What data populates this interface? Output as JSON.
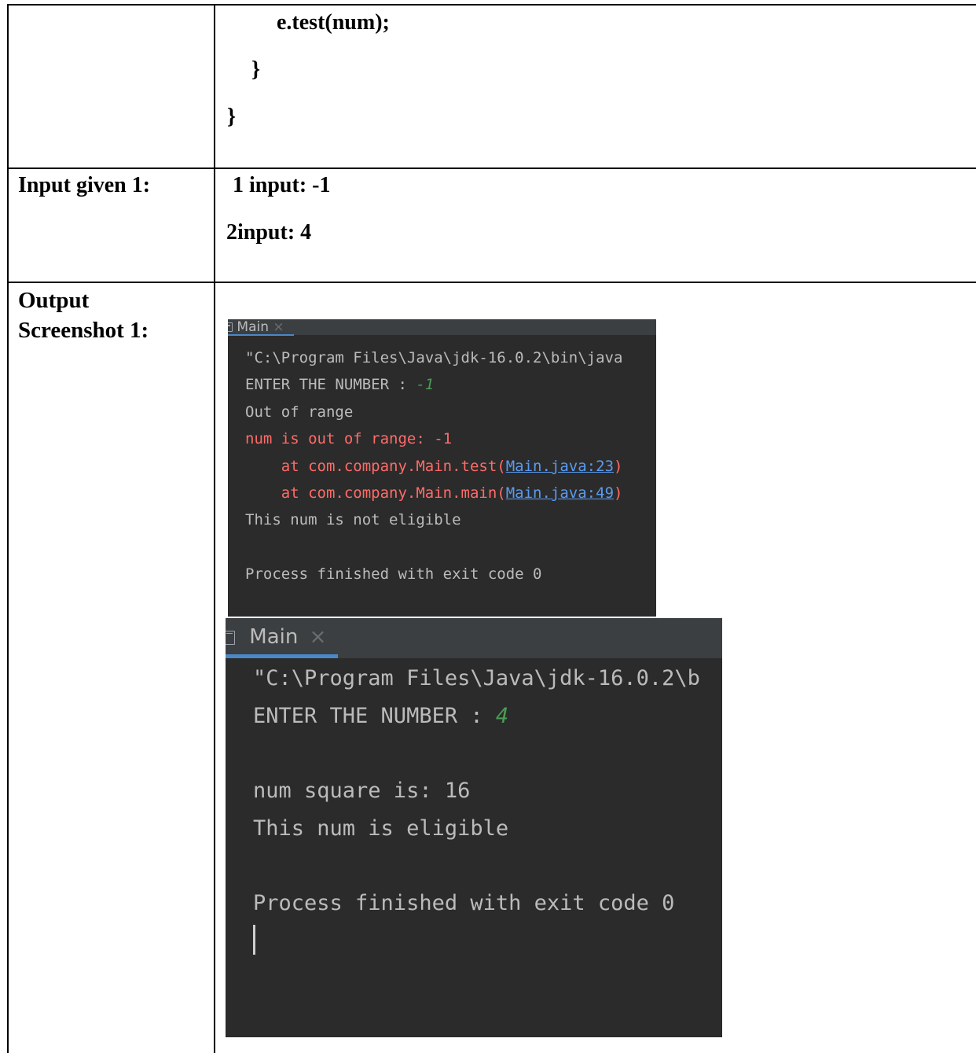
{
  "code_cell": {
    "line1": "e.test(num);",
    "line2": "}",
    "line3": "}"
  },
  "input_row": {
    "label": "Input given 1:",
    "line1": "1 input: -1",
    "line2": "2input: 4"
  },
  "output_row": {
    "label_line1": "Output",
    "label_line2": "Screenshot 1:"
  },
  "console1": {
    "tab_label": "Main",
    "tab_close": "×",
    "lines": {
      "cmd": "\"C:\\Program Files\\Java\\jdk-16.0.2\\bin\\java",
      "prompt": "ENTER THE NUMBER : ",
      "input_value": "-1",
      "out_of_range": "Out of range",
      "exception": "num is out of range: -1",
      "stack1_prefix": "    at com.company.Main.test(",
      "stack1_link": "Main.java:23",
      "stack1_suffix": ")",
      "stack2_prefix": "    at com.company.Main.main(",
      "stack2_link": "Main.java:49",
      "stack2_suffix": ")",
      "not_eligible": "This num is not eligible",
      "exit": "Process finished with exit code 0"
    }
  },
  "console2": {
    "tab_label": "Main",
    "tab_close": "×",
    "lines": {
      "cmd": "\"C:\\Program Files\\Java\\jdk-16.0.2\\b",
      "prompt": "ENTER THE NUMBER : ",
      "input_value": "4",
      "square": "num square is: 16",
      "eligible": "This num is eligible",
      "exit": "Process finished with exit code 0"
    }
  },
  "colors": {
    "console_bg": "#2b2b2b",
    "console_text": "#bbbbbb",
    "error_text": "#ff6b68",
    "input_text": "#499c54",
    "link_text": "#5a9bf0",
    "tab_accent": "#4a88c7"
  },
  "icons": {
    "console_tab_icon": "console-window-icon",
    "tab_close_icon": "close-icon"
  }
}
